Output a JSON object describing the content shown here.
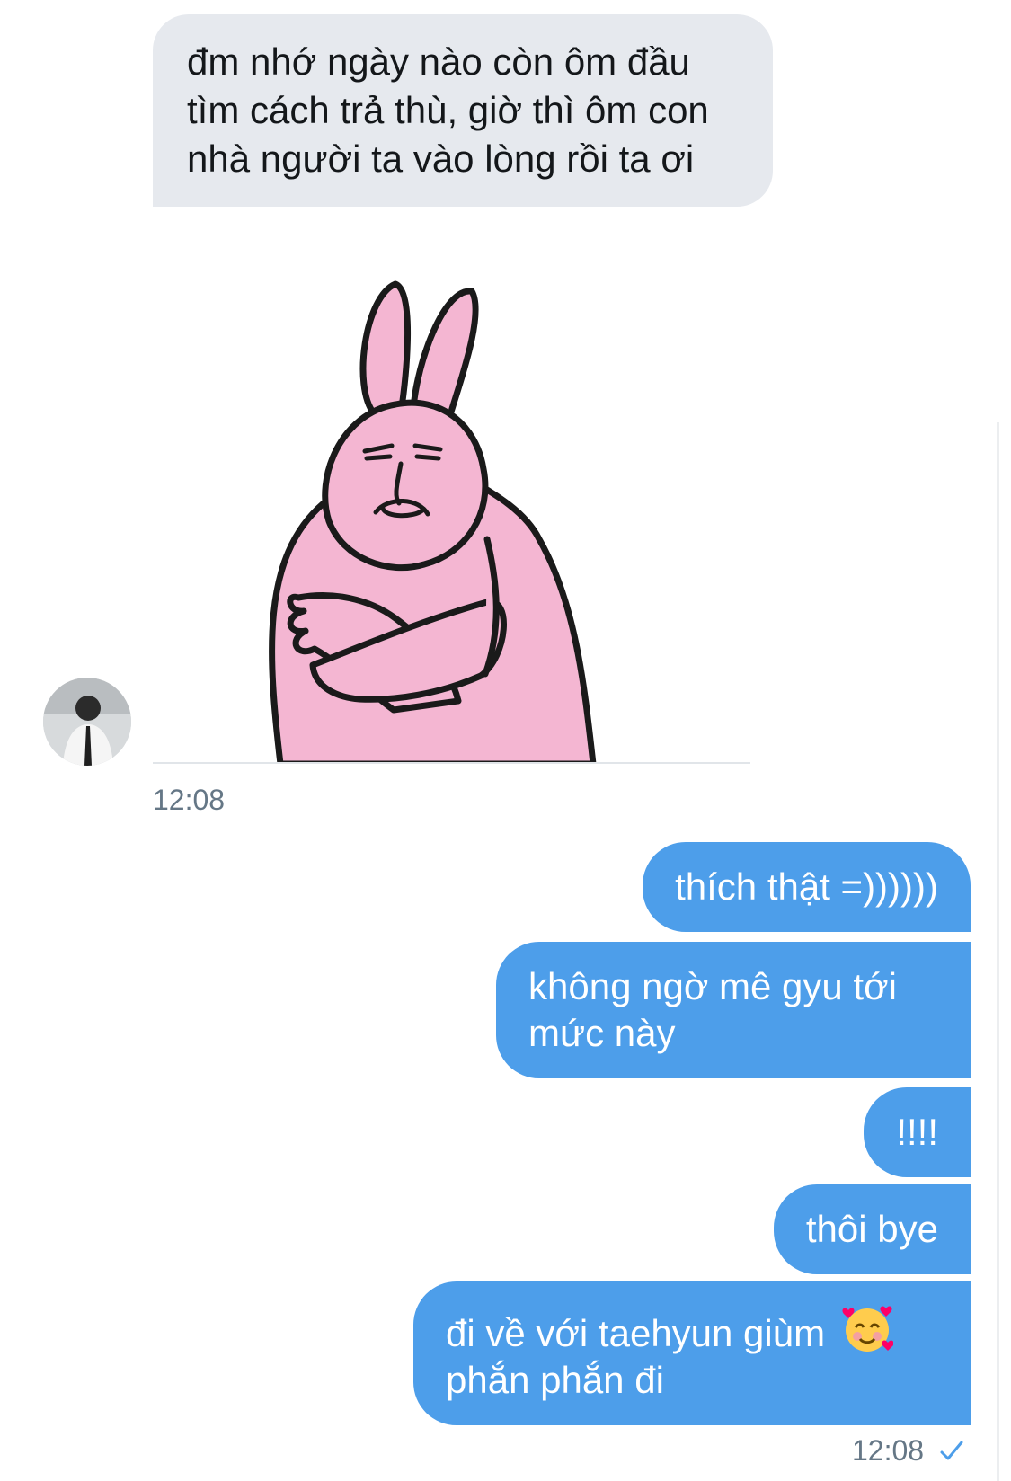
{
  "conversation": {
    "incoming": {
      "text_message": "đm nhớ ngày nào còn ôm đầu tìm cách trả thù, giờ thì ôm con nhà người ta vào lòng rồi ta ơi",
      "sticker_icon": "pink-rabbit-arms-crossed-sticker",
      "avatar_icon": "user-avatar",
      "timestamp": "12:08"
    },
    "outgoing": {
      "messages": [
        "thích thật =))))))",
        "không ngờ mê gyu tới mức này",
        "!!!!",
        "thôi bye",
        "đi về với taehyun giùm"
      ],
      "last_message_line2": "phắn phắn đi",
      "last_message_emoji": "smiling-face-with-hearts-icon",
      "timestamp": "12:08",
      "status_icon": "sent-check-icon"
    }
  },
  "colors": {
    "incoming_bubble": "#e6e9ee",
    "outgoing_bubble": "#4d9eea",
    "timestamp_text": "#657786",
    "check": "#4d9eea"
  }
}
